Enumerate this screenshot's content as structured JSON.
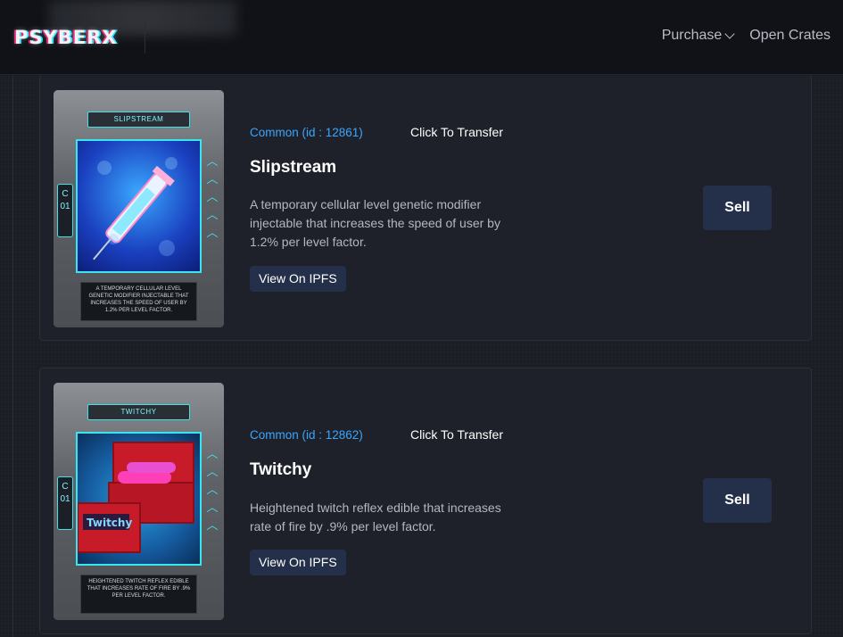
{
  "header": {
    "logo_text": "PSYBERX",
    "nav": [
      {
        "label": "Purchase",
        "has_dropdown": true
      },
      {
        "label": "Open Crates",
        "has_dropdown": false
      }
    ]
  },
  "items": [
    {
      "rarity": "Common (id : 12861)",
      "transfer_label": "Click To Transfer",
      "name": "Slipstream",
      "description": "A temporary cellular level genetic modifier injectable that increases the speed of user by 1.2% per level factor.",
      "ipfs_label": "View On IPFS",
      "sell_label": "Sell",
      "card": {
        "title": "SLIPSTREAM",
        "side_label": "C 01",
        "desc": "A temporary cellular level genetic modifier injectable that increases the speed of user by 1.2% per level factor."
      }
    },
    {
      "rarity": "Common (id : 12862)",
      "transfer_label": "Click To Transfer",
      "name": "Twitchy",
      "description": "Heightened twitch reflex edible that increases rate of fire by .9% per level factor.",
      "ipfs_label": "View On IPFS",
      "sell_label": "Sell",
      "card": {
        "title": "TWITCHY",
        "side_label": "C 01",
        "desc": "Heightened twitch reflex edible that increases rate of fire by .9% per level factor."
      }
    }
  ],
  "colors": {
    "accent_blue": "#3aa6ff",
    "button_bg": "#24304a",
    "card_cyan": "#3fe0e6"
  }
}
